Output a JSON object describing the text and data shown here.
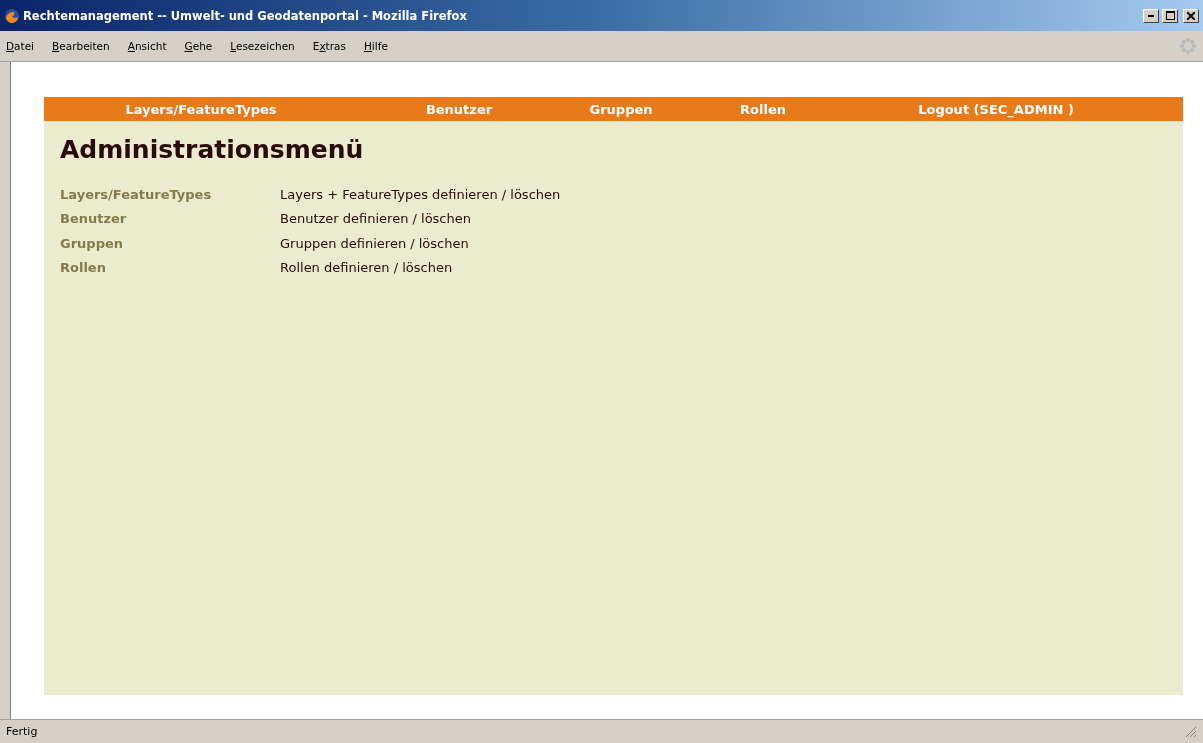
{
  "window": {
    "title": "Rechtemanagement -- Umwelt- und Geodatenportal - Mozilla Firefox"
  },
  "menu_bar": [
    {
      "key": "D",
      "post": "atei"
    },
    {
      "key": "B",
      "post": "earbeiten"
    },
    {
      "key": "A",
      "post": "nsicht"
    },
    {
      "key": "G",
      "post": "ehe"
    },
    {
      "key": "L",
      "post": "esezeichen"
    },
    {
      "pre": "E",
      "key": "x",
      "post": "tras"
    },
    {
      "key": "H",
      "post": "ilfe"
    }
  ],
  "nav": [
    "Layers/FeatureTypes",
    "Benutzer",
    "Gruppen",
    "Rollen",
    "Logout (SEC_ADMIN )"
  ],
  "heading": "Administrationsmenü",
  "entries": [
    {
      "link": "Layers/FeatureTypes",
      "description": "Layers + FeatureTypes definieren / löschen"
    },
    {
      "link": "Benutzer",
      "description": "Benutzer definieren / löschen"
    },
    {
      "link": "Gruppen",
      "description": "Gruppen definieren / löschen"
    },
    {
      "link": "Rollen",
      "description": "Rollen definieren / löschen"
    }
  ],
  "status_bar": {
    "text": "Fertig"
  }
}
